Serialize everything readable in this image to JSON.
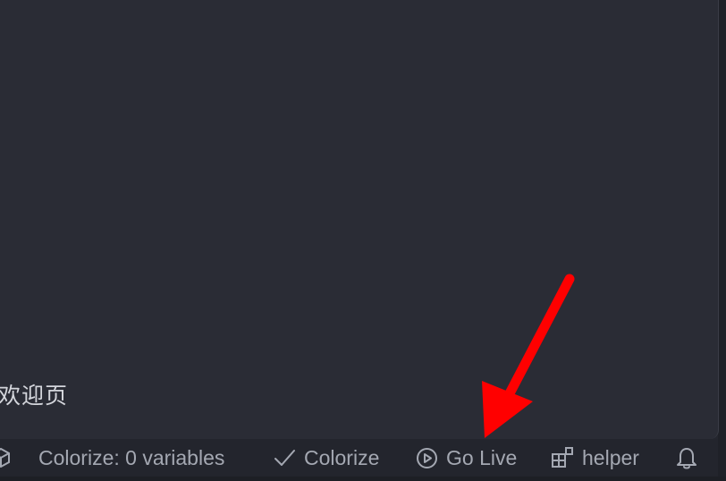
{
  "editor": {
    "welcome_tab_label": "欢迎页"
  },
  "statusbar": {
    "colorize_variables_label": "Colorize: 0 variables",
    "colorize_label": "Colorize",
    "go_live_label": "Go Live",
    "helper_label": "helper"
  },
  "icons": {
    "extension": "cube-icon",
    "check": "check-icon",
    "go_live": "play-circle-icon",
    "helper": "extensions-blocks-icon",
    "notifications": "bell-icon"
  },
  "colors": {
    "editor_background": "#2a2c35",
    "statusbar_background": "#23252d",
    "statusbar_text": "#a4a8b2",
    "annotation_arrow": "#ff0000"
  }
}
